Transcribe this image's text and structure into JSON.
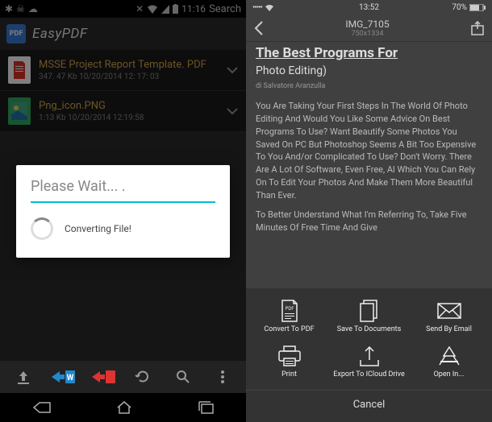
{
  "left": {
    "statusbar": {
      "time": "11:16",
      "search": "Search"
    },
    "app": {
      "title": "EasyPDF",
      "icon_label": "PDF"
    },
    "files": [
      {
        "name": "MSSE Project Report Template. PDF",
        "meta": "347. 47 Kb 10/20/2014 12: 17: 03",
        "type": "pdf"
      },
      {
        "name": "Png_icon.PNG",
        "meta": "1:13 Kb   10/20/2014 12:19:58",
        "type": "png"
      }
    ],
    "dialog": {
      "title": "Please Wait... .",
      "message": "Converting File!"
    }
  },
  "right": {
    "statusbar": {
      "dots": "•••••",
      "time": "13:52",
      "battery": "70%"
    },
    "header": {
      "title": "IMG_7105",
      "subtitle": "750x1334"
    },
    "article": {
      "title": "The Best Programs For",
      "subtitle": "Photo Editing)",
      "author": "di Salvatore Aranzulla",
      "para1": "You Are Taking Your First Steps In The World Of Photo Editing And Would You Like Some Advice On Best Programs To Use? Want Beautify Some Photos You Saved On PC But Photoshop Seems A Bit Too Expensive To You And/or Complicated To Use? Don't Worry. There Are A Lot Of Software, Even Free, Al Which You Can Rely On To Edit Your Photos And Make Them More Beautiful Than Ever.",
      "para2": "To Better Understand What I'm Referring To, Take Five Minutes Of Free Time And Give"
    },
    "actions": {
      "convert_pdf": "Convert To PDF",
      "save_docs": "Save To Documents",
      "send_email": "Send By Email",
      "print": "Print",
      "export_icloud": "Export To ICloud Drive",
      "open_in": "Open In...",
      "cancel": "Cancel"
    }
  }
}
